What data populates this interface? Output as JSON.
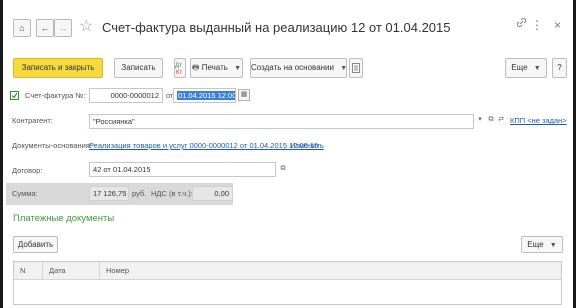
{
  "title": "Счет-фактура выданный на реализацию 12 от 01.04.2015",
  "nav": {
    "home": "⌂",
    "back": "←",
    "forward": "→",
    "star": "☆",
    "link": "🔗",
    "more": "⋮",
    "close": "×"
  },
  "toolbar": {
    "post_close": "Записать и закрыть",
    "save": "Записать",
    "print": "Печать",
    "create_based": "Создать на основании",
    "more": "Еще",
    "help": "?"
  },
  "form": {
    "invoice_label": "Счет-фактура №:",
    "invoice_number": "0000-0000012",
    "from_label": "от:",
    "invoice_date": "01.04.2015 12:00:15",
    "contractor_label": "Контрагент:",
    "contractor_value": "\"Россиянка\"",
    "kpp_link": "КПП <не задан>",
    "base_docs_label": "Документы-основания:",
    "base_docs_link": "Реализация товаров и услуг 0000-0000012 от 01.04.2015 12:00:15",
    "change_link": "Изменить",
    "contract_label": "Договор:",
    "contract_value": "42 от 01.04.2015",
    "sum_label": "Сумма:",
    "sum_value": "17 126,75",
    "currency": "руб.",
    "vat_label": "НДС (в т.ч.):",
    "vat_value": "0,00"
  },
  "payments": {
    "section_title": "Платежные документы",
    "add_button": "Добавить",
    "more": "Еще",
    "columns": [
      "N",
      "Дата",
      "Номер"
    ]
  }
}
